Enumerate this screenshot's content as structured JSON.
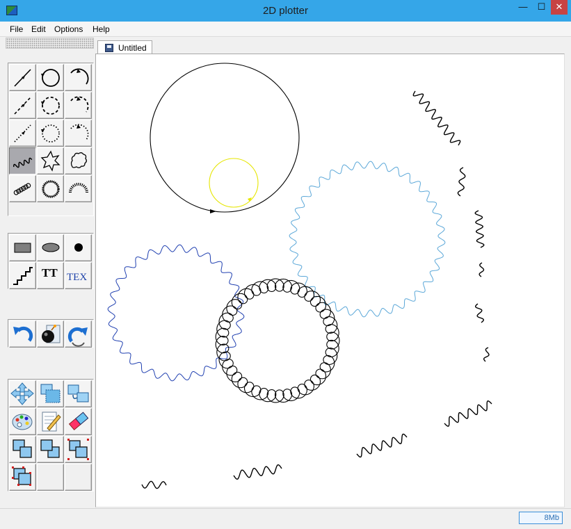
{
  "window": {
    "title": "2D plotter",
    "controls": {
      "minimize": "—",
      "maximize": "☐",
      "close": "✕"
    },
    "accent_color": "#35a6e8"
  },
  "menu": [
    "File",
    "Edit",
    "Options",
    "Help"
  ],
  "document_tab": {
    "label": "Untitled",
    "icon": "disk-icon"
  },
  "toolbar": {
    "groups": [
      {
        "name": "curves",
        "tools": [
          "line-solid-icon",
          "circle-solid-icon",
          "arc-solid-icon",
          "line-dashed-icon",
          "circle-dashed-icon",
          "arc-dashed-icon",
          "line-dotted-icon",
          "circle-dotted-icon",
          "arc-dotted-icon",
          "wave-icon",
          "star-wave-icon",
          "burst-wave-icon",
          "coil-icon",
          "coil-ring-icon",
          "coil-arc-icon"
        ],
        "active": "wave-icon"
      },
      {
        "name": "shapes-text",
        "tools": [
          "rectangle-icon",
          "ellipse-icon",
          "dot-icon",
          "staircase-icon",
          "text-tool-icon",
          "tex-tool-icon"
        ],
        "text_labels": {
          "text_tool": "TT",
          "tex_tool": "TEX"
        }
      },
      {
        "name": "history",
        "tools": [
          "undo-icon",
          "bomb-clear-icon",
          "redo-icon"
        ]
      },
      {
        "name": "editing",
        "tools": [
          "move-arrows-icon",
          "select-region-icon",
          "copy-region-icon",
          "palette-icon",
          "edit-properties-icon",
          "eraser-icon",
          "bring-front-icon",
          "send-back-icon",
          "group-select-icon",
          "ungroup-select-icon"
        ]
      }
    ]
  },
  "status": {
    "memory": "8Mb"
  },
  "colors": {
    "big_circle": "#000000",
    "yellow_circle": "#e6e600",
    "light_blue_wave": "#5aa7d8",
    "dark_blue_wave": "#1f3fb0",
    "coil": "#000000",
    "waves": "#000000"
  }
}
